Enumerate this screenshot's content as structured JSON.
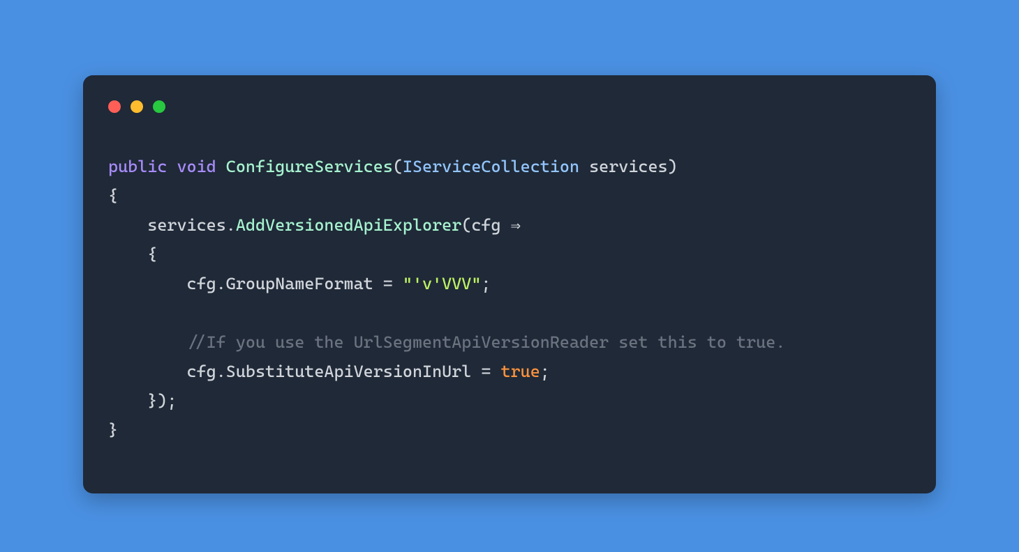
{
  "code": {
    "line1": {
      "kw_public": "public",
      "kw_void": "void",
      "method_name": "ConfigureServices",
      "paren_open": "(",
      "param_type": "IServiceCollection",
      "param_name": "services",
      "paren_close": ")"
    },
    "line2": {
      "text": "{"
    },
    "line3": {
      "indent": "    ",
      "obj": "services",
      "dot": ".",
      "method": "AddVersionedApiExplorer",
      "paren_open": "(",
      "lambda_param": "cfg",
      "arrow": " ⇒"
    },
    "line4": {
      "indent": "    ",
      "text": "{"
    },
    "line5": {
      "indent": "        ",
      "obj": "cfg",
      "dot": ".",
      "prop": "GroupNameFormat",
      "eq": " = ",
      "string": "\"'v'VVV\"",
      "semi": ";"
    },
    "line6": {
      "text": ""
    },
    "line7": {
      "indent": "        ",
      "comment": "//If you use the UrlSegmentApiVersionReader set this to true."
    },
    "line8": {
      "indent": "        ",
      "obj": "cfg",
      "dot": ".",
      "prop": "SubstituteApiVersionInUrl",
      "eq": " = ",
      "bool": "true",
      "semi": ";"
    },
    "line9": {
      "indent": "    ",
      "text": "});"
    },
    "line10": {
      "text": "}"
    }
  }
}
